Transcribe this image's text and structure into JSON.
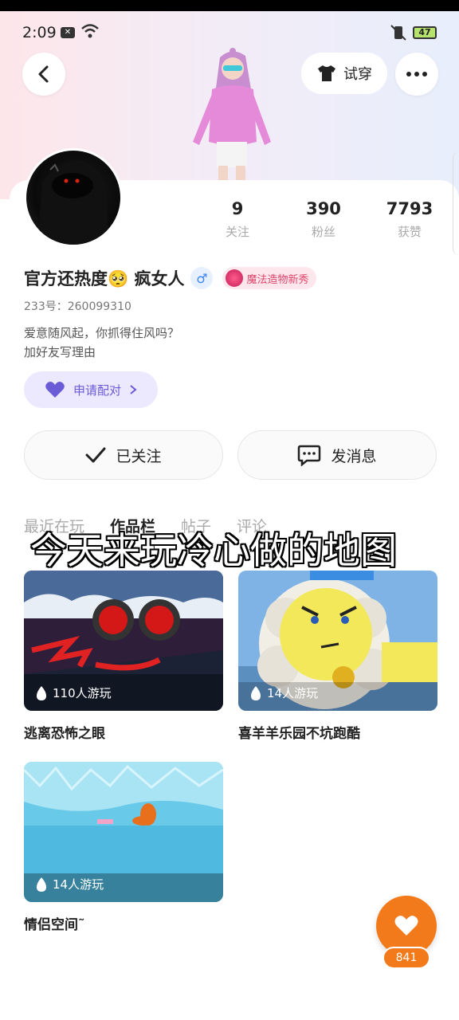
{
  "status_bar": {
    "time": "2:09",
    "battery": "47"
  },
  "header": {
    "try_on_label": "试穿"
  },
  "profile": {
    "name": "官方还热度🥺 疯女人",
    "gender_symbol": "♂",
    "badge_label": "魔法造物新秀",
    "uid": "233号：260099310",
    "bio_lines": [
      "爱意随风起，你抓得住风吗？",
      "加好友写理由"
    ],
    "pair_button_label": "申请配对",
    "stats": [
      {
        "value": "9",
        "label": "关注"
      },
      {
        "value": "390",
        "label": "粉丝"
      },
      {
        "value": "7793",
        "label": "获赞"
      }
    ]
  },
  "actions": {
    "follow_label": "已关注",
    "message_label": "发消息"
  },
  "tabs": [
    {
      "label": "最近在玩"
    },
    {
      "label": "作品栏"
    },
    {
      "label": "帖子"
    },
    {
      "label": "评论"
    }
  ],
  "overlay_caption": "今天来玩冷心做的地图",
  "works": [
    {
      "title": "逃离恐怖之眼",
      "plays": "110人游玩"
    },
    {
      "title": "喜羊羊乐园不坑跑酷",
      "plays": "14人游玩"
    },
    {
      "title": "情侣空间˜",
      "plays": "14人游玩"
    }
  ],
  "like_count": "841",
  "colors": {
    "accent_orange": "#f27a1a",
    "pair_purple": "#6b5bd6",
    "badge_pink": "#e0446a"
  }
}
